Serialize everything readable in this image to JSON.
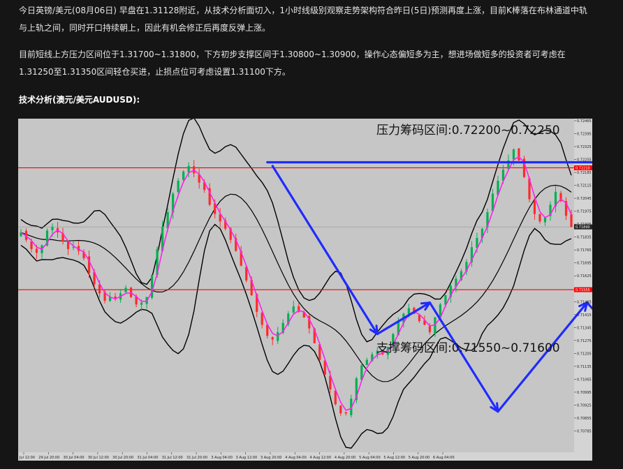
{
  "article": {
    "paragraph1": "今日英镑/美元(08月06日) 早盘在1.31128附近，从技术分析面切入，1小时线级别观察走势架构符合昨日(5日)预测再度上涨，目前K棒落在布林通道中轨与上轨之间，同时开口持续朝上，因此有机会修正后再度反弹上涨。",
    "paragraph2": "目前短线上方压力区间位于1.31700~1.31800，下方初步支撑区间于1.30800~1.30900，操作心态偏短多为主，想进场做短多的投资者可考虑在1.31250至1.31350区间轻仓买进，止损点位可考虑设置1.31100下方。",
    "heading": "技术分析(澳元/美元AUDUSD):"
  },
  "chart_data": {
    "type": "line",
    "annotations": {
      "resistance": "压力筹码区间:0.72200~0.72250",
      "support": "支撑筹码区间:0.71550~0.71600"
    },
    "resistance_line": 0.7221,
    "support_line": 0.7155,
    "resistance_tag": "0.72210",
    "support_tag": "0.71555",
    "current_price": 0.7189,
    "current_tag": "0.71890",
    "ylim": [
      0.7073,
      0.72465
    ],
    "y_ticks": [
      "0.72465",
      "0.72395",
      "0.72325",
      "0.72255",
      "0.72185",
      "0.72115",
      "0.72045",
      "0.71975",
      "0.71905",
      "0.71835",
      "0.71765",
      "0.71695",
      "0.71625",
      "0.71555",
      "0.71485",
      "0.71415",
      "0.71345",
      "0.71275",
      "0.71205",
      "0.71135",
      "0.71065",
      "0.70995",
      "0.70925",
      "0.70855",
      "0.70785"
    ],
    "x_ticks": [
      "28 Jul 12:00",
      "29 Jul 20:00",
      "30 Jul 04:00",
      "30 Jul 12:00",
      "30 Jul 20:00",
      "31 Jul 04:00",
      "31 Jul 12:00",
      "31 Jul 20:00",
      "3 Aug 04:00",
      "3 Aug 12:00",
      "3 Aug 20:00",
      "4 Aug 04:00",
      "4 Aug 12:00",
      "4 Aug 20:00",
      "5 Aug 04:00",
      "5 Aug 12:00",
      "5 Aug 20:00",
      "6 Aug 04:00"
    ],
    "close": [
      0.7186,
      0.7182,
      0.7177,
      0.7175,
      0.7179,
      0.7187,
      0.7189,
      0.7186,
      0.7181,
      0.7177,
      0.7178,
      0.7176,
      0.7172,
      0.7164,
      0.7158,
      0.7153,
      0.7149,
      0.7151,
      0.715,
      0.7153,
      0.7156,
      0.7151,
      0.7147,
      0.7148,
      0.7151,
      0.7163,
      0.7177,
      0.7189,
      0.7197,
      0.7207,
      0.7214,
      0.7219,
      0.7222,
      0.7218,
      0.7213,
      0.7209,
      0.7201,
      0.7196,
      0.7192,
      0.7188,
      0.7182,
      0.7176,
      0.7168,
      0.716,
      0.7152,
      0.7143,
      0.7136,
      0.713,
      0.7128,
      0.7132,
      0.7137,
      0.7142,
      0.7146,
      0.7143,
      0.714,
      0.7134,
      0.7126,
      0.7117,
      0.7109,
      0.7101,
      0.7093,
      0.7088,
      0.7088,
      0.7096,
      0.7107,
      0.7114,
      0.7117,
      0.712,
      0.7122,
      0.712,
      0.7124,
      0.7131,
      0.7138,
      0.7142,
      0.7145,
      0.7142,
      0.7138,
      0.7136,
      0.7132,
      0.714,
      0.7147,
      0.7152,
      0.7157,
      0.7161,
      0.7165,
      0.717,
      0.7178,
      0.7183,
      0.7188,
      0.7197,
      0.7207,
      0.7214,
      0.722,
      0.7225,
      0.7231,
      0.7225,
      0.7216,
      0.7204,
      0.7196,
      0.7192,
      0.7194,
      0.7201,
      0.7208,
      0.7203,
      0.7195,
      0.7189
    ],
    "arrows": [
      {
        "name": "drop-1",
        "from": [
          48,
          0.7222
        ],
        "to": [
          68,
          0.7131
        ],
        "color": "#1f2bff"
      },
      {
        "name": "bounce-1",
        "from": [
          68,
          0.7131
        ],
        "to": [
          78,
          0.7148
        ],
        "color": "#1f2bff"
      },
      {
        "name": "drop-2",
        "from": [
          78,
          0.7148
        ],
        "to": [
          91,
          0.7089
        ],
        "color": "#1f2bff"
      },
      {
        "name": "rally-1",
        "from": [
          91,
          0.7089
        ],
        "to": [
          108,
          0.7148
        ],
        "color": "#1f2bff"
      },
      {
        "name": "dip-1",
        "from": [
          108,
          0.7148
        ],
        "to": [
          115,
          0.7126
        ],
        "color": "#1f2bff"
      },
      {
        "name": "rally-2",
        "from": [
          115,
          0.7126
        ],
        "to": [
          140,
          0.722
        ],
        "color": "#1f2bff"
      },
      {
        "name": "top-line",
        "from": [
          47,
          0.7224
        ],
        "to": [
          141,
          0.7224
        ],
        "color": "#1f2bff"
      },
      {
        "name": "green-down-1",
        "from": [
          144,
          0.7222
        ],
        "to": [
          150,
          0.719
        ],
        "color": "#22ee22"
      },
      {
        "name": "green-up",
        "from": [
          150,
          0.719
        ],
        "to": [
          157,
          0.7208
        ],
        "color": "#22ee22"
      },
      {
        "name": "green-down-2",
        "from": [
          157,
          0.7208
        ],
        "to": [
          165,
          0.7157
        ],
        "color": "#22ee22"
      }
    ],
    "grid": false,
    "background": "#c6c6c6",
    "colors": {
      "bull": "#00b050",
      "bear": "#ff2a2a",
      "ma": "#ff22ee",
      "band": "#000000",
      "hline": "#ff0000",
      "arrow_blue": "#1f2bff",
      "arrow_green": "#22ee22",
      "circle": "#1f6bff"
    }
  }
}
